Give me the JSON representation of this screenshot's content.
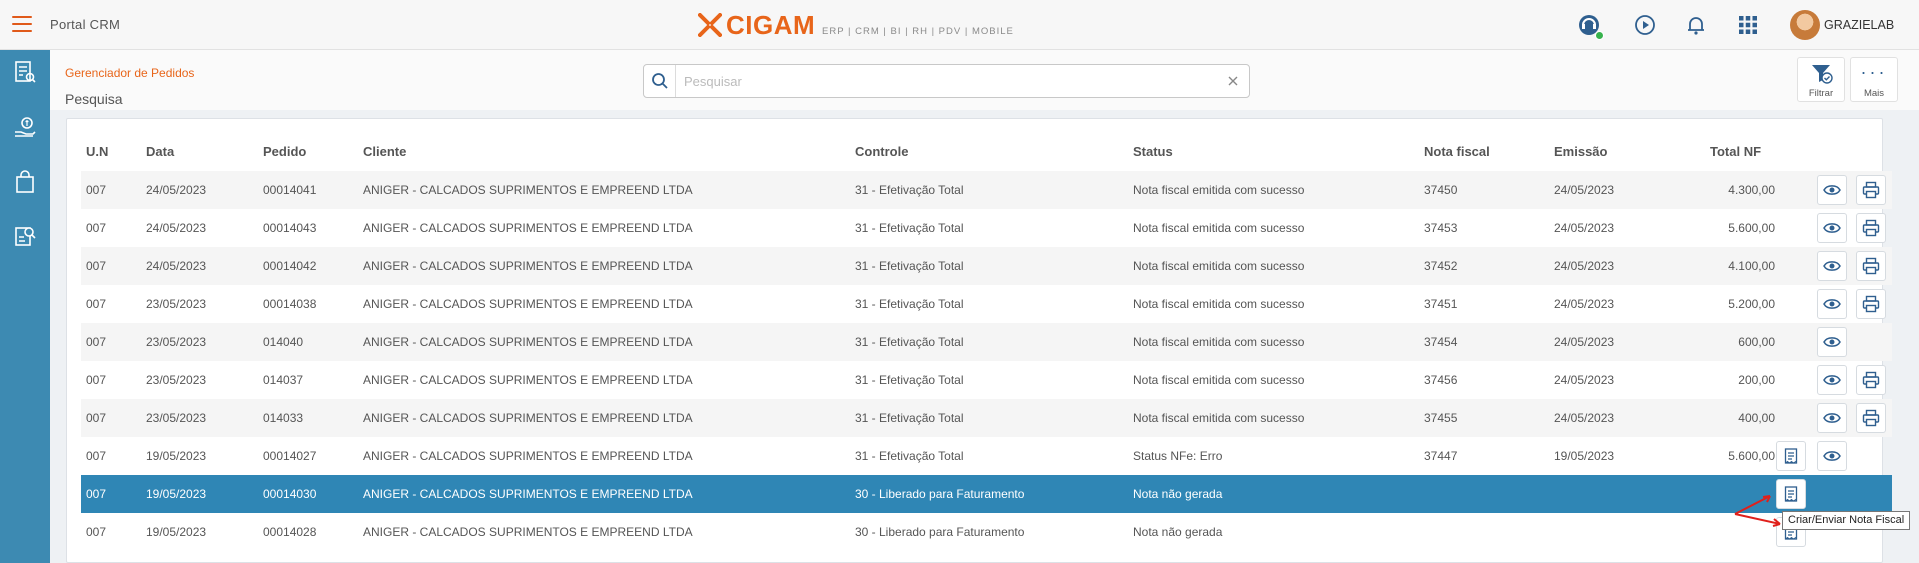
{
  "app": {
    "title": "Portal CRM",
    "logo_text": "CIGAM",
    "logo_tagline": "ERP | CRM | BI | RH | PDV | MOBILE",
    "username": "GRAZIELAB",
    "accent_color": "#e8651a",
    "sidebar_color": "#3d8ab2"
  },
  "header": {
    "breadcrumb": "Gerenciador de Pedidos",
    "page_title": "Pesquisa",
    "search_placeholder": "Pesquisar",
    "search_value": "",
    "filter_label": "Filtrar",
    "more_label": "Mais"
  },
  "topbar_icons": [
    "support-chat-icon",
    "play-icon",
    "bell-icon",
    "apps-grid-icon"
  ],
  "sidebar_icons": [
    "report-list-icon",
    "money-hand-icon",
    "shopping-bag-icon",
    "document-search-icon"
  ],
  "table": {
    "columns": [
      "U.N",
      "Data",
      "Pedido",
      "Cliente",
      "Controle",
      "Status",
      "Nota fiscal",
      "Emissão",
      "Total NF"
    ],
    "rows": [
      {
        "un": "007",
        "data": "24/05/2023",
        "pedido": "00014041",
        "cliente": "ANIGER - CALCADOS SUPRIMENTOS E EMPREEND LTDA",
        "controle": "31 - Efetivação Total",
        "status": "Nota fiscal emitida com sucesso",
        "nota": "37450",
        "emissao": "24/05/2023",
        "total": "4.300,00"
      },
      {
        "un": "007",
        "data": "24/05/2023",
        "pedido": "00014043",
        "cliente": "ANIGER - CALCADOS SUPRIMENTOS E EMPREEND LTDA",
        "controle": "31 - Efetivação Total",
        "status": "Nota fiscal emitida com sucesso",
        "nota": "37453",
        "emissao": "24/05/2023",
        "total": "5.600,00"
      },
      {
        "un": "007",
        "data": "24/05/2023",
        "pedido": "00014042",
        "cliente": "ANIGER - CALCADOS SUPRIMENTOS E EMPREEND LTDA",
        "controle": "31 - Efetivação Total",
        "status": "Nota fiscal emitida com sucesso",
        "nota": "37452",
        "emissao": "24/05/2023",
        "total": "4.100,00"
      },
      {
        "un": "007",
        "data": "23/05/2023",
        "pedido": "00014038",
        "cliente": "ANIGER - CALCADOS SUPRIMENTOS E EMPREEND LTDA",
        "controle": "31 - Efetivação Total",
        "status": "Nota fiscal emitida com sucesso",
        "nota": "37451",
        "emissao": "24/05/2023",
        "total": "5.200,00"
      },
      {
        "un": "007",
        "data": "23/05/2023",
        "pedido": "014040",
        "cliente": "ANIGER - CALCADOS SUPRIMENTOS E EMPREEND LTDA",
        "controle": "31 - Efetivação Total",
        "status": "Nota fiscal emitida com sucesso",
        "nota": "37454",
        "emissao": "24/05/2023",
        "total": "600,00"
      },
      {
        "un": "007",
        "data": "23/05/2023",
        "pedido": "014037",
        "cliente": "ANIGER - CALCADOS SUPRIMENTOS E EMPREEND LTDA",
        "controle": "31 - Efetivação Total",
        "status": "Nota fiscal emitida com sucesso",
        "nota": "37456",
        "emissao": "24/05/2023",
        "total": "200,00"
      },
      {
        "un": "007",
        "data": "23/05/2023",
        "pedido": "014033",
        "cliente": "ANIGER - CALCADOS SUPRIMENTOS E EMPREEND LTDA",
        "controle": "31 - Efetivação Total",
        "status": "Nota fiscal emitida com sucesso",
        "nota": "37455",
        "emissao": "24/05/2023",
        "total": "400,00"
      },
      {
        "un": "007",
        "data": "19/05/2023",
        "pedido": "00014027",
        "cliente": "ANIGER - CALCADOS SUPRIMENTOS E EMPREEND LTDA",
        "controle": "31 - Efetivação Total",
        "status": "Status NFe: Erro",
        "nota": "37447",
        "emissao": "19/05/2023",
        "total": "5.600,00"
      },
      {
        "un": "007",
        "data": "19/05/2023",
        "pedido": "00014030",
        "cliente": "ANIGER - CALCADOS SUPRIMENTOS E EMPREEND LTDA",
        "controle": "30 - Liberado para Faturamento",
        "status": "Nota não gerada",
        "nota": "",
        "emissao": "",
        "total": ""
      },
      {
        "un": "007",
        "data": "19/05/2023",
        "pedido": "00014028",
        "cliente": "ANIGER - CALCADOS SUPRIMENTOS E EMPREEND LTDA",
        "controle": "30 - Liberado para Faturamento",
        "status": "Nota não gerada",
        "nota": "",
        "emissao": "",
        "total": ""
      }
    ]
  },
  "tooltip": "Criar/Enviar Nota Fiscal"
}
